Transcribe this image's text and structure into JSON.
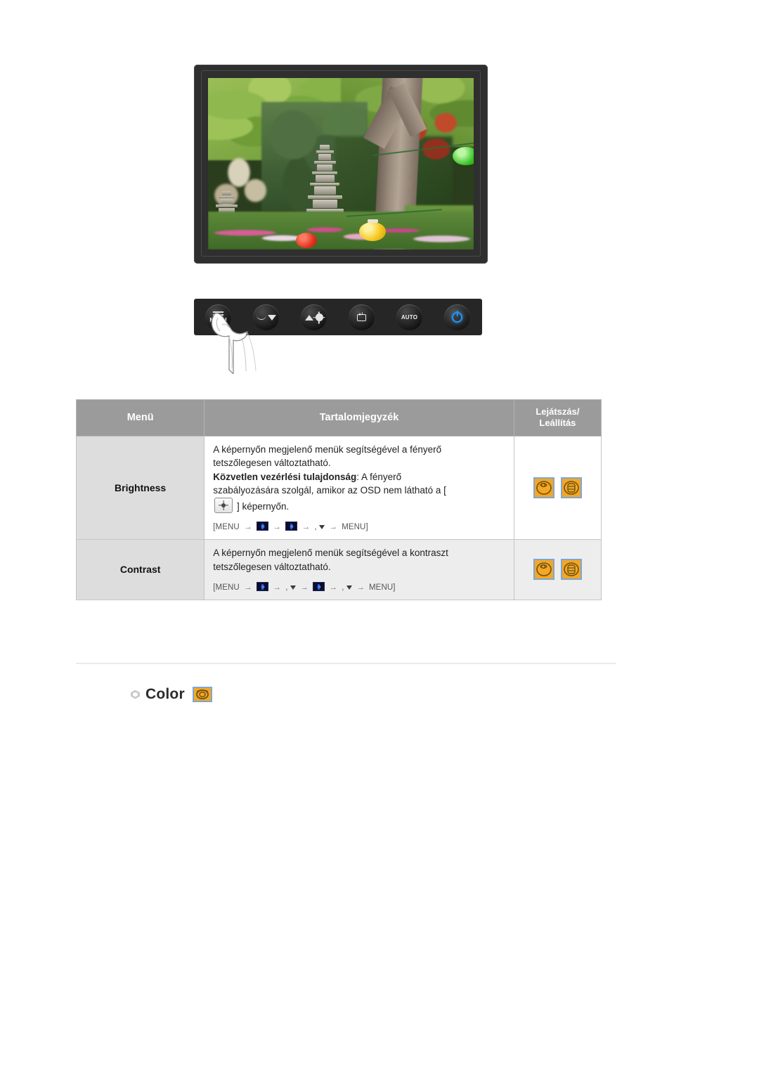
{
  "monitor": {
    "caption_alt": "LCD monitor displaying a garden photograph with a stone pagoda",
    "screen_scene": {
      "description": "Korean garden with stone pagoda, green trees, flower bed and paper lanterns",
      "lanterns": [
        "red-lantern",
        "yellow-lantern",
        "green-lantern"
      ]
    }
  },
  "control_panel": {
    "buttons": [
      {
        "name": "menu-button",
        "label": "MENU",
        "icon": "menu-bars-icon"
      },
      {
        "name": "down-button",
        "label": "",
        "icon": "wave-down-icon"
      },
      {
        "name": "brightness-button",
        "label": "",
        "icon": "mountain-sun-icon"
      },
      {
        "name": "enter-button",
        "label": "",
        "icon": "enter-icon"
      },
      {
        "name": "auto-button",
        "label": "AUTO",
        "icon": "auto-text-icon"
      },
      {
        "name": "power-button",
        "label": "",
        "icon": "power-icon"
      }
    ],
    "pressed_button": "menu-button",
    "hand_cursor": "pressing-hand-icon"
  },
  "table": {
    "headers": {
      "menu": "Menü",
      "contents": "Tartalomjegyzék",
      "play_stop_line1": "Lejátszás/",
      "play_stop_line2": "Leállítás"
    },
    "rows": [
      {
        "name": "Brightness",
        "desc_line1": "A képernyőn megjelenő menük segítségével a fényerő",
        "desc_line2": "tetszőlegesen változtatható.",
        "desc_bold": "Közvetlen vezérlési tulajdonság",
        "desc_line3_after_bold": ": A fényerő",
        "desc_line4": "szabályozására szolgál, amikor az OSD nem látható a [",
        "desc_inline_icon": "brightness-sun-icon",
        "desc_line5": "] képernyőn.",
        "sequence": {
          "open": "[MENU",
          "close": "MENU]",
          "steps": [
            "osd-icon-1",
            "osd-icon-2",
            "down-key"
          ]
        },
        "icons": [
          "play-icon",
          "stop-icon"
        ]
      },
      {
        "name": "Contrast",
        "desc_line1": "A képernyőn megjelenő menük segítségével a kontraszt",
        "desc_line2": "tetszőlegesen változtatható.",
        "sequence": {
          "open": "[MENU",
          "close": "MENU]",
          "steps": [
            "osd-icon-1",
            "down-key",
            "osd-icon-3",
            "down-key"
          ]
        },
        "icons": [
          "play-icon",
          "stop-icon"
        ]
      }
    ]
  },
  "section": {
    "color_heading": "Color",
    "color_icon": "color-osd-icon"
  },
  "colors": {
    "header_bg": "#9b9b9b",
    "name_cell_bg": "#dddddd",
    "shaded_cell_bg": "#ededed",
    "icon_orange": "#f5a623",
    "icon_border_blue": "#7ba7d7",
    "power_blue": "#2196f3",
    "page_bg": "#ffffff"
  }
}
